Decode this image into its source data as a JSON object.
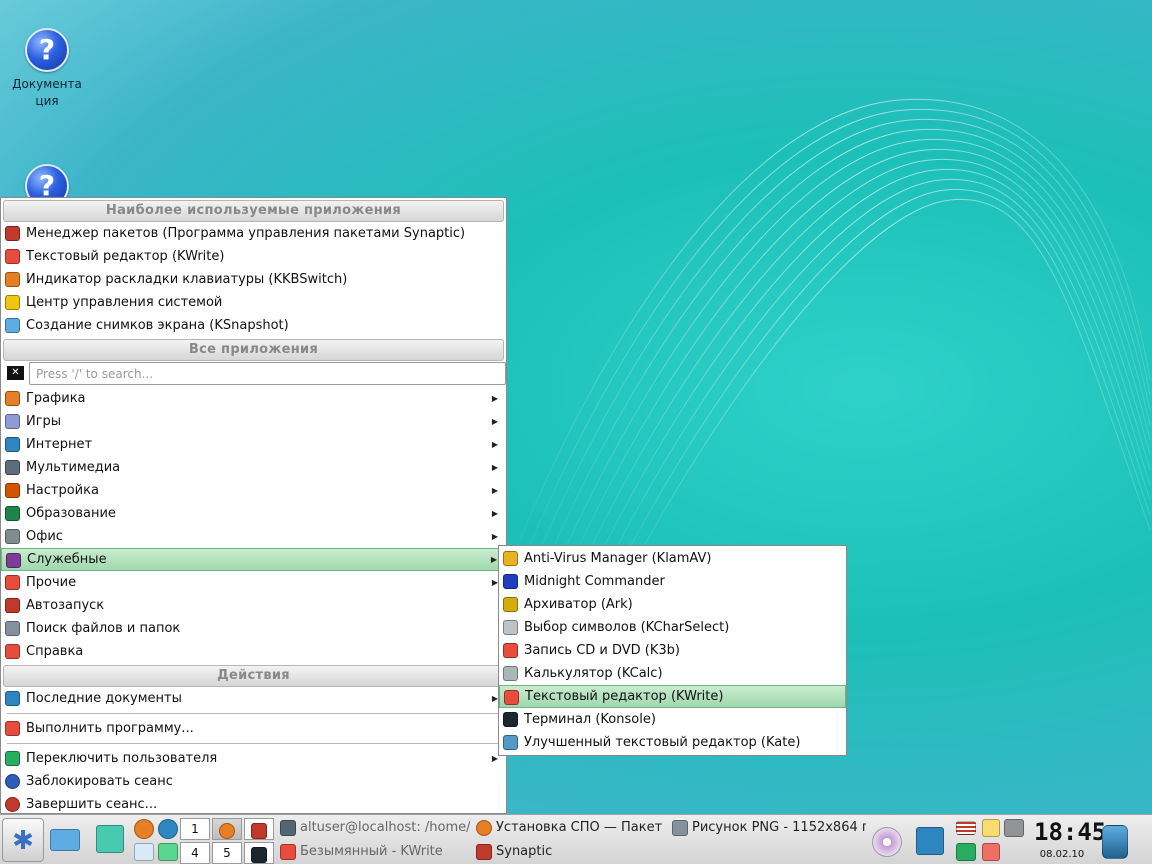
{
  "colors": {
    "highlight": "#9fd8ad",
    "menu_bg": "#ffffff",
    "header_text": "#888888"
  },
  "desktop": {
    "icons": [
      {
        "label": "Документа\nция",
        "icon": "help-icon"
      },
      {
        "label": "",
        "icon": "help-icon"
      }
    ]
  },
  "kmenu": {
    "header_frequent": "Наиболее используемые приложения",
    "frequent": [
      {
        "label": "Менеджер пакетов (Программа управления пакетами Synaptic)",
        "icon": "synaptic-icon",
        "color": "#c0392b"
      },
      {
        "label": "Текстовый редактор (KWrite)",
        "icon": "kwrite-icon",
        "color": "#e74c3c"
      },
      {
        "label": "Индикатор раскладки клавиатуры (KKBSwitch)",
        "icon": "kkbswitch-icon",
        "color": "#e67e22"
      },
      {
        "label": "Центр управления системой",
        "icon": "control-center-icon",
        "color": "#f1c40f"
      },
      {
        "label": "Создание снимков экрана (KSnapshot)",
        "icon": "ksnapshot-icon",
        "color": "#5dade2"
      }
    ],
    "header_all": "Все приложения",
    "search_placeholder": "Press '/' to search...",
    "categories": [
      {
        "label": "Графика",
        "icon": "graphics-icon",
        "color": "#e67e22"
      },
      {
        "label": "Игры",
        "icon": "games-icon",
        "color": "#8e9bd6"
      },
      {
        "label": "Интернет",
        "icon": "internet-icon",
        "color": "#2e86c1"
      },
      {
        "label": "Мультимедиа",
        "icon": "multimedia-icon",
        "color": "#5d6d7e"
      },
      {
        "label": "Настройка",
        "icon": "settings-icon",
        "color": "#d35400"
      },
      {
        "label": "Образование",
        "icon": "education-icon",
        "color": "#1e8449"
      },
      {
        "label": "Офис",
        "icon": "office-icon",
        "color": "#7f8c8d"
      },
      {
        "label": "Служебные",
        "icon": "utilities-icon",
        "color": "#7d3c98"
      },
      {
        "label": "Прочие",
        "icon": "other-icon",
        "color": "#e74c3c"
      }
    ],
    "plain": [
      {
        "label": "Автозапуск",
        "icon": "autostart-icon",
        "color": "#c0392b"
      },
      {
        "label": "Поиск файлов и папок",
        "icon": "find-icon",
        "color": "#85929e"
      },
      {
        "label": "Справка",
        "icon": "help-lifebuoy-icon",
        "color": "#e74c3c"
      }
    ],
    "header_actions": "Действия",
    "recent_docs": "Последние документы",
    "run_program": "Выполнить программу...",
    "switch_user": "Переключить пользователя",
    "lock_session": "Заблокировать сеанс",
    "logout": "Завершить сеанс..."
  },
  "submenu": {
    "items": [
      {
        "label": "Anti-Virus Manager (KlamAV)",
        "icon": "klamav-icon",
        "color": "#e6b422"
      },
      {
        "label": "Midnight Commander",
        "icon": "mc-icon",
        "color": "#1f3fbf"
      },
      {
        "label": "Архиватор (Ark)",
        "icon": "ark-icon",
        "color": "#d4ac0d"
      },
      {
        "label": "Выбор символов (KCharSelect)",
        "icon": "kcharselect-icon",
        "color": "#bdc3c7"
      },
      {
        "label": "Запись CD и DVD (K3b)",
        "icon": "k3b-icon",
        "color": "#e74c3c"
      },
      {
        "label": "Калькулятор (KCalc)",
        "icon": "kcalc-icon",
        "color": "#aab7b8"
      },
      {
        "label": "Текстовый редактор (KWrite)",
        "icon": "kwrite-icon",
        "color": "#e74c3c"
      },
      {
        "label": "Терминал (Konsole)",
        "icon": "konsole-icon",
        "color": "#1b2631"
      },
      {
        "label": "Улучшенный текстовый редактор (Kate)",
        "icon": "kate-icon",
        "color": "#5499c7"
      }
    ]
  },
  "taskbar": {
    "pager": [
      "1",
      "4",
      "5"
    ],
    "tasks": [
      {
        "label": "altuser@localhost: /home/",
        "icon": "terminal-icon",
        "color": "#566573"
      },
      {
        "label": "Установка СПО — Пакет",
        "icon": "firefox-icon",
        "color": "#e67e22"
      },
      {
        "label": "Рисунок PNG - 1152x864 п",
        "icon": "image-icon",
        "color": "#85929e"
      },
      {
        "label": "Безымянный - KWrite",
        "icon": "kwrite-icon",
        "color": "#e74c3c"
      },
      {
        "label": "Synaptic",
        "icon": "synaptic-icon",
        "color": "#c0392b"
      }
    ],
    "clock": "18:45",
    "date": "08.02.10"
  }
}
